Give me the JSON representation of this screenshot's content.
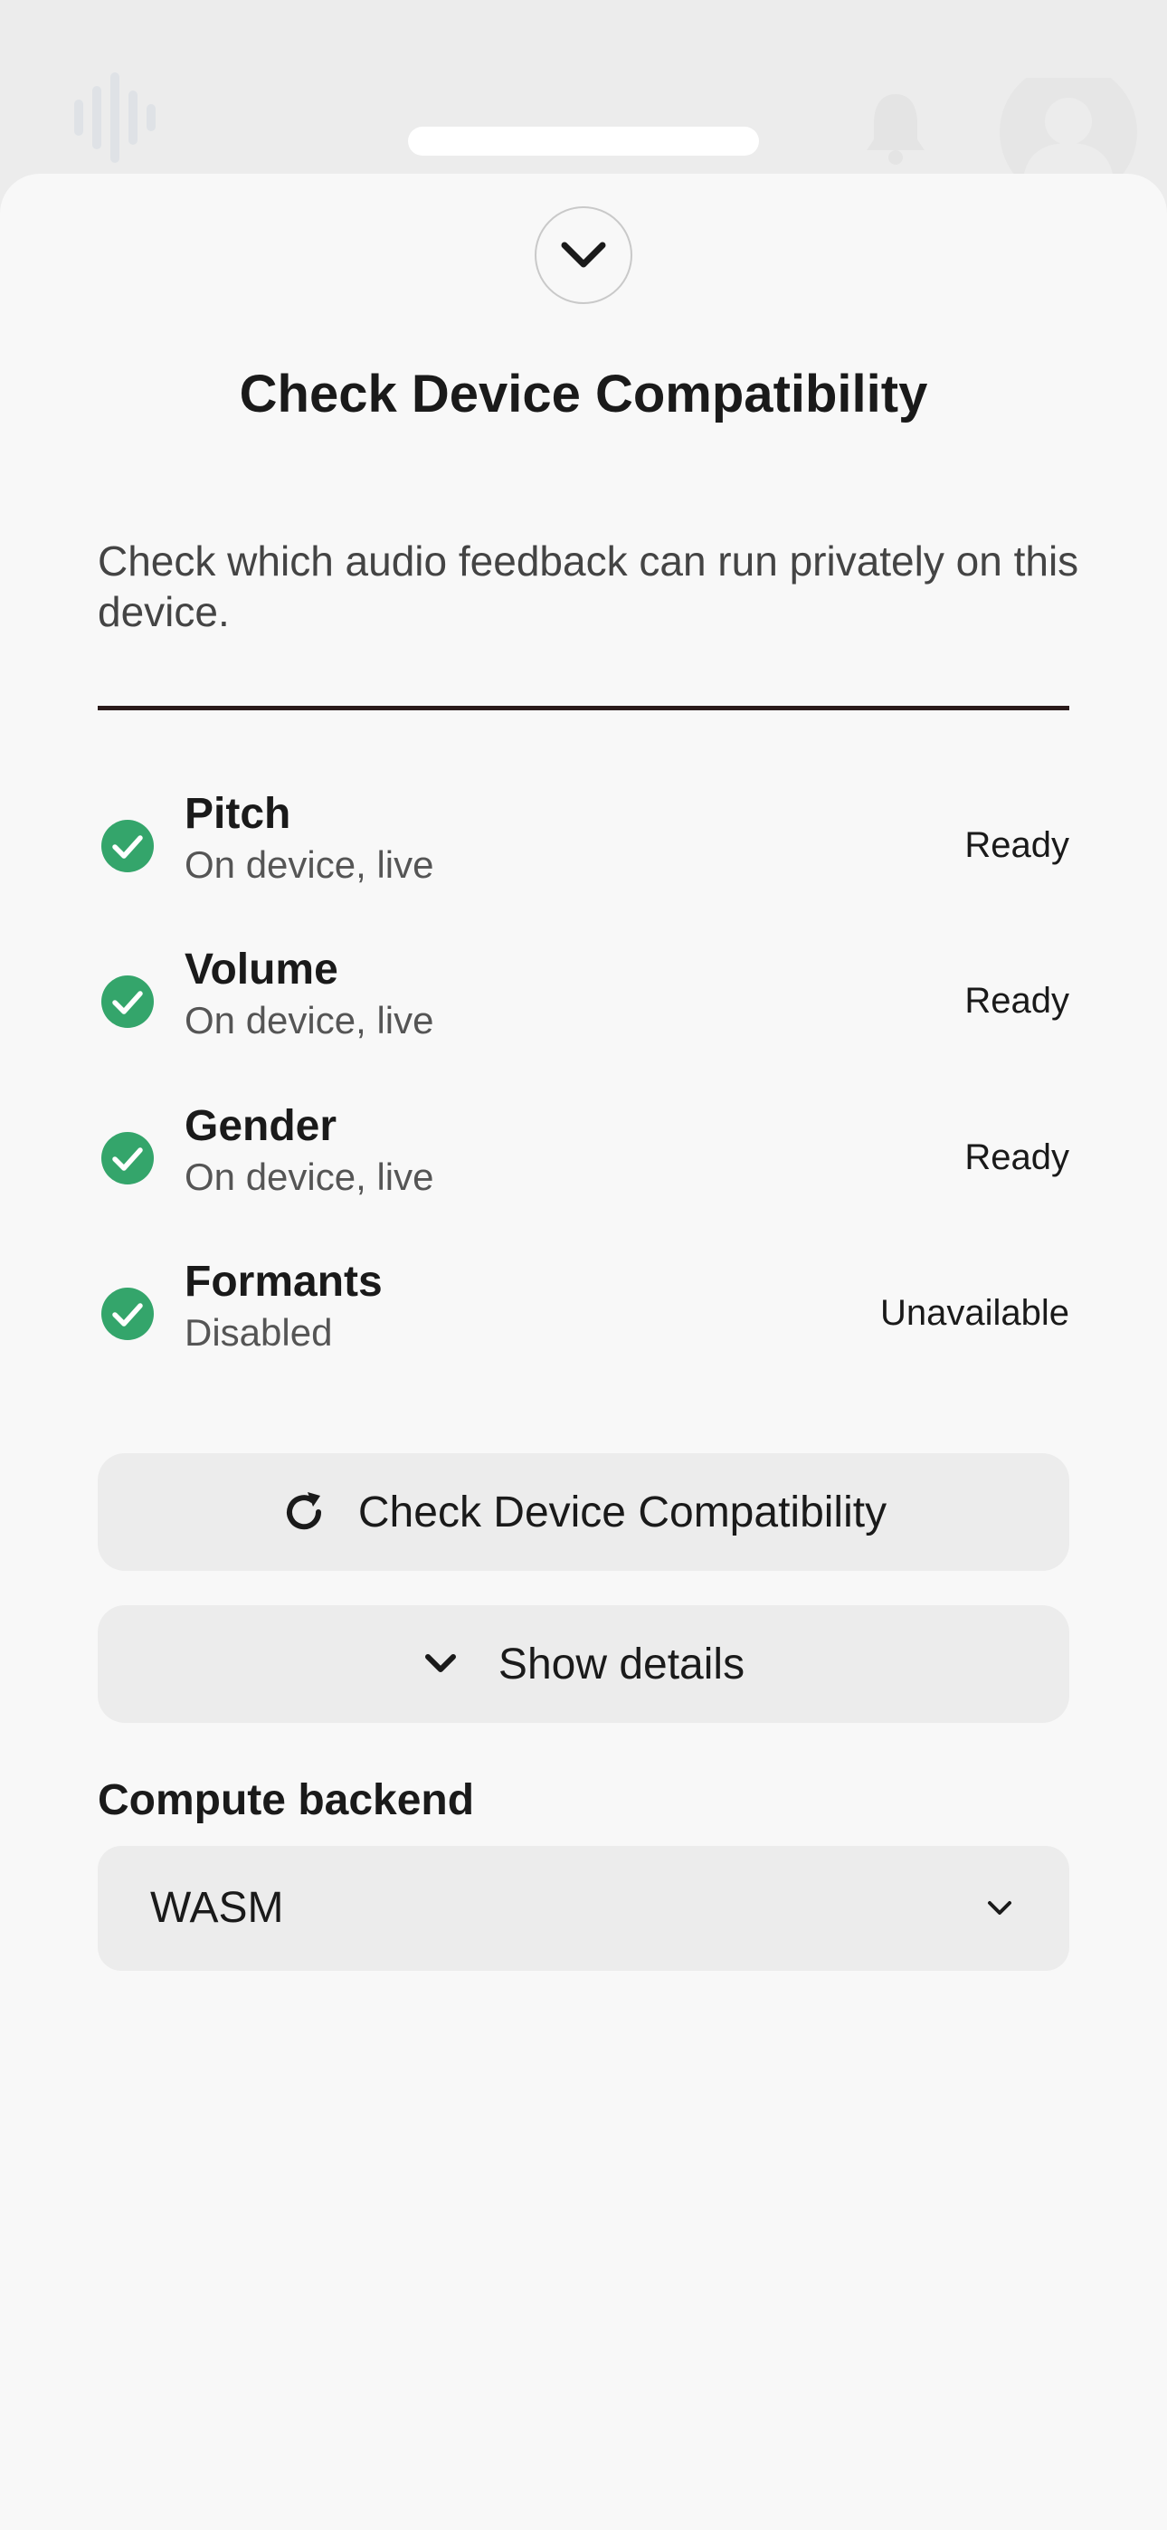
{
  "sheet": {
    "title": "Check Device Compatibility",
    "description": "Check which audio feedback can run privately on this device."
  },
  "features": [
    {
      "name": "Pitch",
      "subtitle": "On device, live",
      "status": "Ready",
      "icon": "check-circle-icon"
    },
    {
      "name": "Volume",
      "subtitle": "On device, live",
      "status": "Ready",
      "icon": "check-circle-icon"
    },
    {
      "name": "Gender",
      "subtitle": "On device, live",
      "status": "Ready",
      "icon": "check-circle-icon"
    },
    {
      "name": "Formants",
      "subtitle": "Disabled",
      "status": "Unavailable",
      "icon": "check-circle-icon"
    }
  ],
  "actions": {
    "check_label": "Check Device Compatibility",
    "details_label": "Show details"
  },
  "backend": {
    "label": "Compute backend",
    "selected": "WASM"
  },
  "colors": {
    "accent_green": "#34a56b",
    "sheet_bg": "#f8f8f8",
    "button_bg": "#ececec",
    "text": "#1a1a1a"
  }
}
